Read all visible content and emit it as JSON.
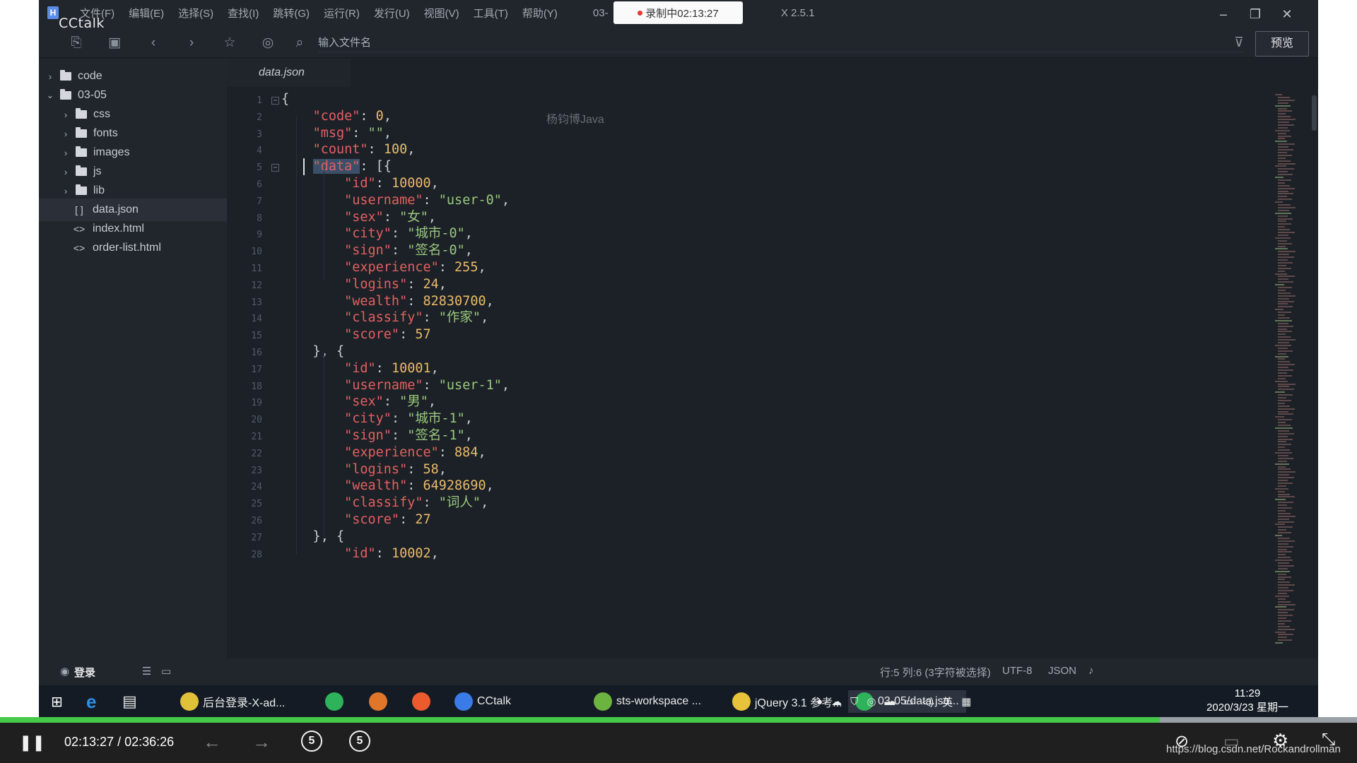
{
  "window": {
    "logo_letter": "H",
    "cctalk_tag": "CCtalk",
    "title_prefix": "03-",
    "version_suffix": "X 2.5.1",
    "recording_badge": "录制中02:13:27",
    "menus": [
      "文件(F)",
      "编辑(E)",
      "选择(S)",
      "查找(I)",
      "跳转(G)",
      "运行(R)",
      "发行(U)",
      "视图(V)",
      "工具(T)",
      "帮助(Y)"
    ]
  },
  "toolbar": {
    "file_input_placeholder": "输入文件名",
    "preview_label": "预览"
  },
  "sidebar": {
    "items": [
      {
        "label": "code",
        "kind": "folder",
        "expanded": false
      },
      {
        "label": "03-05",
        "kind": "folder",
        "expanded": true
      },
      {
        "label": "css",
        "kind": "folder",
        "expanded": false
      },
      {
        "label": "fonts",
        "kind": "folder",
        "expanded": false
      },
      {
        "label": "images",
        "kind": "folder",
        "expanded": false
      },
      {
        "label": "js",
        "kind": "folder",
        "expanded": false
      },
      {
        "label": "lib",
        "kind": "folder",
        "expanded": false
      },
      {
        "label": "data.json",
        "kind": "json",
        "symbol": "[ ]",
        "selected": true
      },
      {
        "label": "index.html",
        "kind": "html",
        "symbol": "<>"
      },
      {
        "label": "order-list.html",
        "kind": "html",
        "symbol": "<>"
      }
    ]
  },
  "editor": {
    "tab_label": "data.json",
    "watermark": "杨钧博Java",
    "lines": [
      [
        [
          "p",
          "{"
        ]
      ],
      [
        [
          "p",
          "    "
        ],
        [
          "k",
          "\"code\""
        ],
        [
          "p",
          ": "
        ],
        [
          "n",
          "0"
        ],
        [
          "p",
          ","
        ]
      ],
      [
        [
          "p",
          "    "
        ],
        [
          "k",
          "\"msg\""
        ],
        [
          "p",
          ": "
        ],
        [
          "s",
          "\"\""
        ],
        [
          "p",
          ","
        ]
      ],
      [
        [
          "p",
          "    "
        ],
        [
          "k",
          "\"count\""
        ],
        [
          "p",
          ": "
        ],
        [
          "n",
          "100"
        ],
        [
          "p",
          ","
        ]
      ],
      [
        [
          "p",
          "    "
        ],
        [
          "k",
          "\"data\""
        ],
        [
          "p",
          ": [{"
        ]
      ],
      [
        [
          "p",
          "        "
        ],
        [
          "k",
          "\"id\""
        ],
        [
          "p",
          ": "
        ],
        [
          "n",
          "10000"
        ],
        [
          "p",
          ","
        ]
      ],
      [
        [
          "p",
          "        "
        ],
        [
          "k",
          "\"username\""
        ],
        [
          "p",
          ": "
        ],
        [
          "s",
          "\"user-0\""
        ],
        [
          "p",
          ","
        ]
      ],
      [
        [
          "p",
          "        "
        ],
        [
          "k",
          "\"sex\""
        ],
        [
          "p",
          ": "
        ],
        [
          "s",
          "\"女\""
        ],
        [
          "p",
          ","
        ]
      ],
      [
        [
          "p",
          "        "
        ],
        [
          "k",
          "\"city\""
        ],
        [
          "p",
          ": "
        ],
        [
          "s",
          "\"城市-0\""
        ],
        [
          "p",
          ","
        ]
      ],
      [
        [
          "p",
          "        "
        ],
        [
          "k",
          "\"sign\""
        ],
        [
          "p",
          ": "
        ],
        [
          "s",
          "\"签名-0\""
        ],
        [
          "p",
          ","
        ]
      ],
      [
        [
          "p",
          "        "
        ],
        [
          "k",
          "\"experience\""
        ],
        [
          "p",
          ": "
        ],
        [
          "n",
          "255"
        ],
        [
          "p",
          ","
        ]
      ],
      [
        [
          "p",
          "        "
        ],
        [
          "k",
          "\"logins\""
        ],
        [
          "p",
          ": "
        ],
        [
          "n",
          "24"
        ],
        [
          "p",
          ","
        ]
      ],
      [
        [
          "p",
          "        "
        ],
        [
          "k",
          "\"wealth\""
        ],
        [
          "p",
          ": "
        ],
        [
          "n",
          "82830700"
        ],
        [
          "p",
          ","
        ]
      ],
      [
        [
          "p",
          "        "
        ],
        [
          "k",
          "\"classify\""
        ],
        [
          "p",
          ": "
        ],
        [
          "s",
          "\"作家\""
        ],
        [
          "p",
          ","
        ]
      ],
      [
        [
          "p",
          "        "
        ],
        [
          "k",
          "\"score\""
        ],
        [
          "p",
          ": "
        ],
        [
          "n",
          "57"
        ]
      ],
      [
        [
          "p",
          "    }, {"
        ]
      ],
      [
        [
          "p",
          "        "
        ],
        [
          "k",
          "\"id\""
        ],
        [
          "p",
          ": "
        ],
        [
          "n",
          "10001"
        ],
        [
          "p",
          ","
        ]
      ],
      [
        [
          "p",
          "        "
        ],
        [
          "k",
          "\"username\""
        ],
        [
          "p",
          ": "
        ],
        [
          "s",
          "\"user-1\""
        ],
        [
          "p",
          ","
        ]
      ],
      [
        [
          "p",
          "        "
        ],
        [
          "k",
          "\"sex\""
        ],
        [
          "p",
          ": "
        ],
        [
          "s",
          "\"男\""
        ],
        [
          "p",
          ","
        ]
      ],
      [
        [
          "p",
          "        "
        ],
        [
          "k",
          "\"city\""
        ],
        [
          "p",
          ": "
        ],
        [
          "s",
          "\"城市-1\""
        ],
        [
          "p",
          ","
        ]
      ],
      [
        [
          "p",
          "        "
        ],
        [
          "k",
          "\"sign\""
        ],
        [
          "p",
          ": "
        ],
        [
          "s",
          "\"签名-1\""
        ],
        [
          "p",
          ","
        ]
      ],
      [
        [
          "p",
          "        "
        ],
        [
          "k",
          "\"experience\""
        ],
        [
          "p",
          ": "
        ],
        [
          "n",
          "884"
        ],
        [
          "p",
          ","
        ]
      ],
      [
        [
          "p",
          "        "
        ],
        [
          "k",
          "\"logins\""
        ],
        [
          "p",
          ": "
        ],
        [
          "n",
          "58"
        ],
        [
          "p",
          ","
        ]
      ],
      [
        [
          "p",
          "        "
        ],
        [
          "k",
          "\"wealth\""
        ],
        [
          "p",
          ": "
        ],
        [
          "n",
          "64928690"
        ],
        [
          "p",
          ","
        ]
      ],
      [
        [
          "p",
          "        "
        ],
        [
          "k",
          "\"classify\""
        ],
        [
          "p",
          ": "
        ],
        [
          "s",
          "\"词人\""
        ],
        [
          "p",
          ","
        ]
      ],
      [
        [
          "p",
          "        "
        ],
        [
          "k",
          "\"score\""
        ],
        [
          "p",
          ": "
        ],
        [
          "n",
          "27"
        ]
      ],
      [
        [
          "p",
          "    }, {"
        ]
      ],
      [
        [
          "p",
          "        "
        ],
        [
          "k",
          "\"id\""
        ],
        [
          "p",
          ": "
        ],
        [
          "n",
          "10002"
        ],
        [
          "p",
          ","
        ]
      ]
    ]
  },
  "status": {
    "login": "登录",
    "cursor": "行:5  列:6 (3字符被选择)",
    "encoding": "UTF-8",
    "language": "JSON"
  },
  "taskbar": {
    "apps": [
      {
        "label": "后台登录-X-ad...",
        "icon": "chrome-icon",
        "color": "#e0c13a"
      },
      {
        "label": "",
        "icon": "player-icon",
        "color": "#2fb35a"
      },
      {
        "label": "",
        "icon": "git-icon",
        "color": "#e0762a"
      },
      {
        "label": "",
        "icon": "firefox-icon",
        "color": "#ec5b2d"
      },
      {
        "label": "CCtalk",
        "icon": "cctalk-icon",
        "color": "#3b7be8"
      },
      {
        "label": "sts-workspace ...",
        "icon": "spring-icon",
        "color": "#6cb33f"
      },
      {
        "label": "jQuery 3.1 参考...",
        "icon": "help-icon",
        "color": "#e8c23a"
      },
      {
        "label": "03-05/data.jso...",
        "icon": "hbuilder-icon",
        "color": "#2fb35a"
      }
    ],
    "ime": "英",
    "clock_time": "11:29",
    "clock_date": "2020/3/23 星期一"
  },
  "player": {
    "current_time": "02:13:27",
    "total_time": "02:36:26",
    "progress_fraction": 0.8545,
    "rewind_label": "5",
    "forward_label": "5",
    "url_note": "https://blog.csdn.net/Rockandrollman"
  },
  "colors": {
    "key": "#e36060",
    "string": "#9ac87d",
    "number": "#e8bb69",
    "progress": "#44c948"
  }
}
